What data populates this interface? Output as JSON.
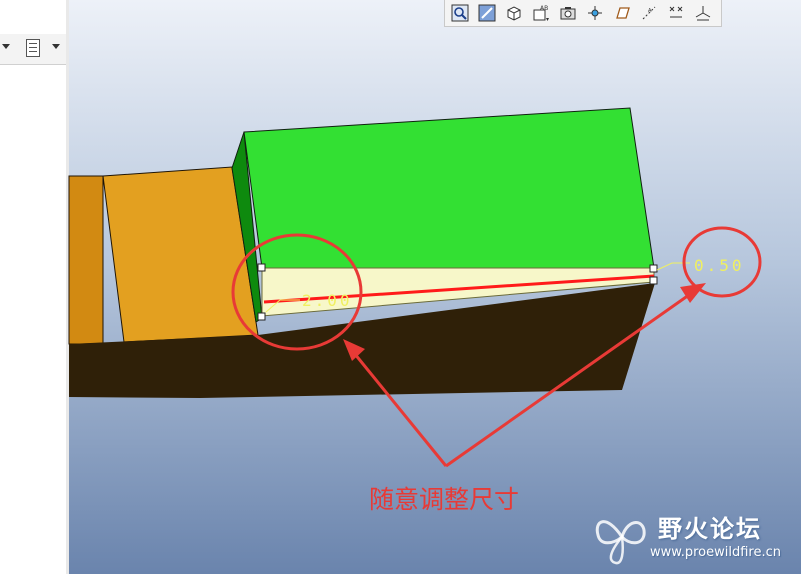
{
  "toolbar": {
    "icons": [
      "zoom-window-icon",
      "view-orient-icon",
      "shade-mode-icon",
      "named-view-icon",
      "snapshot-icon",
      "spin-center-icon",
      "plane-display-icon",
      "axis-display-icon",
      "point-display-icon",
      "csys-display-icon"
    ]
  },
  "left_panel": {
    "icons": [
      "dropdown-arrow-icon",
      "layer-list-icon",
      "dropdown-arrow-icon"
    ]
  },
  "dimensions": {
    "left": "2.00",
    "right": "0.50"
  },
  "annotation": {
    "label": "随意调整尺寸",
    "color": "#e83a36"
  },
  "watermark": {
    "title": "野火论坛",
    "url": "www.proewildfire.cn"
  },
  "colors": {
    "green_face": "#33e033",
    "orange_face": "#e3a020",
    "dark_face": "#2f2008",
    "dimension_text": "#f0f060",
    "red_line": "#ff1a1a"
  }
}
